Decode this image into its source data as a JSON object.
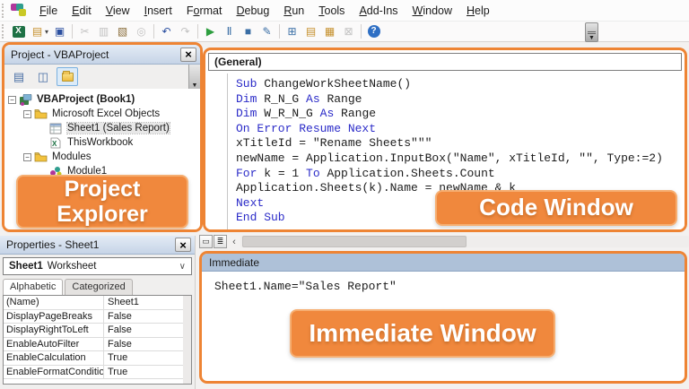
{
  "colors": {
    "accent": "#EE8434",
    "label_bg": "#F0883D",
    "label_border": "#F6AE71",
    "keyword_blue": "#2B2BC8",
    "immediate_titlebar": "#AEC1D8"
  },
  "menu": {
    "items": [
      {
        "label": "File",
        "accel": 0
      },
      {
        "label": "Edit",
        "accel": 0
      },
      {
        "label": "View",
        "accel": 0
      },
      {
        "label": "Insert",
        "accel": 0
      },
      {
        "label": "Format",
        "accel": 1
      },
      {
        "label": "Debug",
        "accel": 0
      },
      {
        "label": "Run",
        "accel": 0
      },
      {
        "label": "Tools",
        "accel": 0
      },
      {
        "label": "Add-Ins",
        "accel": 0
      },
      {
        "label": "Window",
        "accel": 0
      },
      {
        "label": "Help",
        "accel": 0
      }
    ]
  },
  "toolbar": {
    "groups": [
      [
        {
          "name": "view-excel-icon",
          "glyph": "X",
          "box_bg": "#1E7145",
          "box_fg": "#ffffff"
        },
        {
          "name": "insert-userform-icon",
          "glyph": "▤",
          "fg": "#C58F2A",
          "caret": true
        },
        {
          "name": "save-icon",
          "glyph": "▣",
          "fg": "#2B4FA0"
        }
      ],
      [
        {
          "name": "cut-icon",
          "glyph": "✂",
          "fg": "#666666",
          "disabled": true
        },
        {
          "name": "copy-icon",
          "glyph": "▥",
          "fg": "#666666",
          "disabled": true
        },
        {
          "name": "paste-icon",
          "glyph": "▧",
          "fg": "#8A6D3B"
        },
        {
          "name": "find-icon",
          "glyph": "◎",
          "fg": "#666666",
          "disabled": true
        }
      ],
      [
        {
          "name": "undo-icon",
          "glyph": "↶",
          "fg": "#2B4FA0"
        },
        {
          "name": "redo-icon",
          "glyph": "↷",
          "fg": "#666666",
          "disabled": true
        }
      ],
      [
        {
          "name": "run-icon",
          "glyph": "▶",
          "fg": "#2E9E3F"
        },
        {
          "name": "break-icon",
          "glyph": "Ⅱ",
          "fg": "#3A6EA5"
        },
        {
          "name": "reset-icon",
          "glyph": "■",
          "fg": "#3A6EA5"
        },
        {
          "name": "design-mode-icon",
          "glyph": "✎",
          "fg": "#3A6EA5"
        }
      ],
      [
        {
          "name": "project-explorer-icon",
          "glyph": "⊞",
          "fg": "#3A6EA5"
        },
        {
          "name": "properties-window-icon",
          "glyph": "▤",
          "fg": "#C58F2A"
        },
        {
          "name": "object-browser-icon",
          "glyph": "▦",
          "fg": "#C58F2A"
        },
        {
          "name": "toolbox-icon",
          "glyph": "⊠",
          "fg": "#666666",
          "disabled": true
        }
      ],
      [
        {
          "name": "help-icon",
          "glyph": "?",
          "circle": true
        }
      ]
    ]
  },
  "project": {
    "title": "Project - VBAProject",
    "close_glyph": "×",
    "overlay_label": "Project Explorer",
    "toolbar_icons": [
      {
        "name": "view-code-icon",
        "glyph": "▤"
      },
      {
        "name": "view-object-icon",
        "glyph": "◫"
      },
      {
        "name": "toggle-folders-icon",
        "glyph": "folder",
        "active": true
      }
    ],
    "tree": [
      {
        "label": "VBAProject (Book1)",
        "icon": "project",
        "level": 0,
        "bold": true,
        "expander": true
      },
      {
        "label": "Microsoft Excel Objects",
        "icon": "folder",
        "level": 1,
        "expander": true
      },
      {
        "label": "Sheet1 (Sales Report)",
        "icon": "sheet",
        "level": 2,
        "selected": true
      },
      {
        "label": "ThisWorkbook",
        "icon": "workbook",
        "level": 2
      },
      {
        "label": "Modules",
        "icon": "folder",
        "level": 1,
        "expander": true
      },
      {
        "label": "Module1",
        "icon": "module",
        "level": 2
      }
    ]
  },
  "code": {
    "dropdown": "(General)",
    "overlay_label": "Code Window",
    "lines": [
      [
        {
          "t": "Sub ",
          "k": true
        },
        {
          "t": "ChangeWorkSheetName()"
        }
      ],
      [
        {
          "t": "Dim ",
          "k": true
        },
        {
          "t": "R_N_G "
        },
        {
          "t": "As ",
          "k": true
        },
        {
          "t": "Range"
        }
      ],
      [
        {
          "t": "Dim ",
          "k": true
        },
        {
          "t": "W_R_N_G "
        },
        {
          "t": "As ",
          "k": true
        },
        {
          "t": "Range"
        }
      ],
      [
        {
          "t": "On Error Resume Next",
          "k": true
        }
      ],
      [
        {
          "t": "xTitleId = \"Rename Sheets\"\"\""
        }
      ],
      [
        {
          "t": "newName = Application.InputBox(\"Name\", xTitleId, \"\", Type:=2)"
        }
      ],
      [
        {
          "t": "For ",
          "k": true
        },
        {
          "t": "k = 1 "
        },
        {
          "t": "To ",
          "k": true
        },
        {
          "t": "Application.Sheets.Count"
        }
      ],
      [
        {
          "t": "Application.Sheets(k).Name = newName & k"
        }
      ],
      [
        {
          "t": "Next",
          "k": true
        }
      ],
      [
        {
          "t": "End Sub",
          "k": true
        }
      ]
    ]
  },
  "properties": {
    "title": "Properties - Sheet1",
    "close_glyph": "×",
    "selector_name": "Sheet1",
    "selector_type": "Worksheet",
    "tabs": [
      {
        "label": "Alphabetic",
        "active": true
      },
      {
        "label": "Categorized",
        "active": false
      }
    ],
    "rows": [
      [
        "(Name)",
        "Sheet1"
      ],
      [
        "DisplayPageBreaks",
        "False"
      ],
      [
        "DisplayRightToLeft",
        "False"
      ],
      [
        "EnableAutoFilter",
        "False"
      ],
      [
        "EnableCalculation",
        "True"
      ],
      [
        "EnableFormatConditions",
        "True"
      ]
    ]
  },
  "immediate": {
    "title": "Immediate",
    "content": "Sheet1.Name=\"Sales Report\"",
    "overlay_label": "Immediate Window"
  }
}
